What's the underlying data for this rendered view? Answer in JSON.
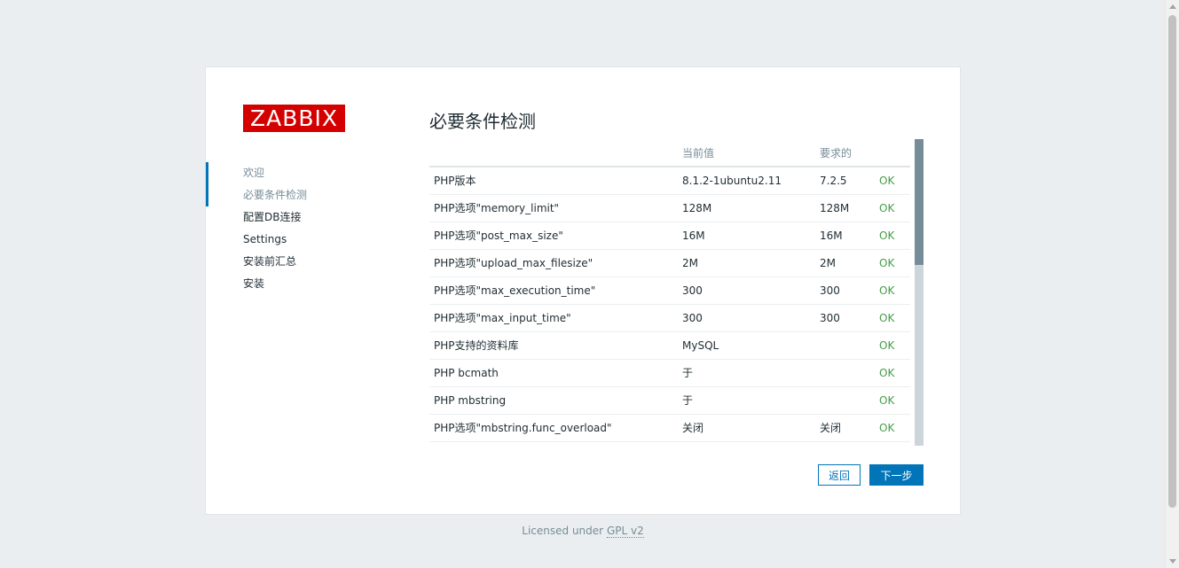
{
  "logo": {
    "text": "ZABBIX",
    "color": "#d40000"
  },
  "steps": [
    {
      "label": "欢迎",
      "state": "done"
    },
    {
      "label": "必要条件检测",
      "state": "current"
    },
    {
      "label": "配置DB连接",
      "state": "pending"
    },
    {
      "label": "Settings",
      "state": "pending"
    },
    {
      "label": "安装前汇总",
      "state": "pending"
    },
    {
      "label": "安装",
      "state": "pending"
    }
  ],
  "main": {
    "title": "必要条件检测",
    "columns": {
      "name": "",
      "current": "当前值",
      "required": "要求的",
      "result": ""
    },
    "rows": [
      {
        "name": "PHP版本",
        "current": "8.1.2-1ubuntu2.11",
        "required": "7.2.5",
        "result": "OK"
      },
      {
        "name": "PHP选项\"memory_limit\"",
        "current": "128M",
        "required": "128M",
        "result": "OK"
      },
      {
        "name": "PHP选项\"post_max_size\"",
        "current": "16M",
        "required": "16M",
        "result": "OK"
      },
      {
        "name": "PHP选项\"upload_max_filesize\"",
        "current": "2M",
        "required": "2M",
        "result": "OK"
      },
      {
        "name": "PHP选项\"max_execution_time\"",
        "current": "300",
        "required": "300",
        "result": "OK"
      },
      {
        "name": "PHP选项\"max_input_time\"",
        "current": "300",
        "required": "300",
        "result": "OK"
      },
      {
        "name": "PHP支持的资料库",
        "current": "MySQL",
        "required": "",
        "result": "OK"
      },
      {
        "name": "PHP bcmath",
        "current": "于",
        "required": "",
        "result": "OK"
      },
      {
        "name": "PHP mbstring",
        "current": "于",
        "required": "",
        "result": "OK"
      },
      {
        "name": "PHP选项\"mbstring.func_overload\"",
        "current": "关闭",
        "required": "关闭",
        "result": "OK"
      }
    ]
  },
  "buttons": {
    "back": "返回",
    "next": "下一步"
  },
  "footer": {
    "prefix": "Licensed under",
    "link": "GPL v2"
  },
  "colors": {
    "accent": "#0275b8",
    "ok": "#429e47",
    "background": "#ebeef0"
  }
}
